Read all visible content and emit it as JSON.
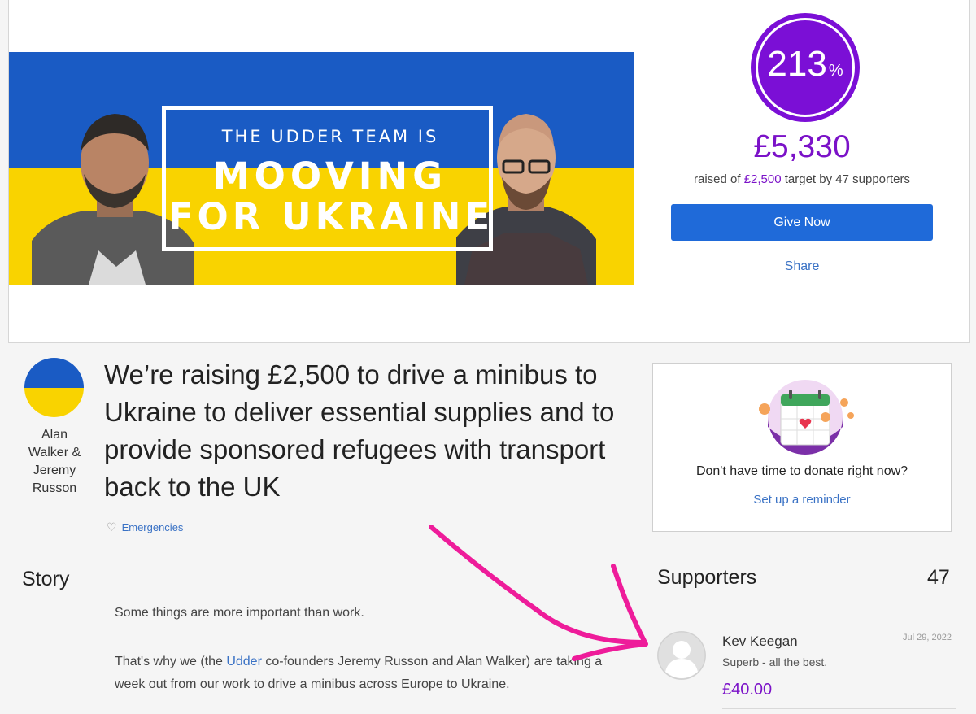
{
  "banner": {
    "line1": "THE UDDER TEAM IS",
    "line2": "MOOVING",
    "line3": "FOR UKRAINE"
  },
  "progress": {
    "percent": "213",
    "percent_symbol": "%",
    "amount": "£5,330",
    "raised_of": "raised of ",
    "target": "£2,500",
    "target_by": " target by ",
    "supporters_count": "47",
    "supporters_label": " supporters"
  },
  "actions": {
    "give_now": "Give Now",
    "share": "Share"
  },
  "owner": {
    "name_lines": [
      "Alan",
      "Walker &",
      "Jeremy",
      "Russon"
    ]
  },
  "campaign": {
    "title": "We’re raising £2,500 to drive a minibus to Ukraine to deliver essential supplies and to provide sponsored refugees with transport back to the UK",
    "category": "Emergencies"
  },
  "reminder": {
    "text": "Don't have time to donate right now?",
    "link": "Set up a reminder"
  },
  "story": {
    "heading": "Story",
    "p1": "Some things are more important than work.",
    "p2_before": "That's why we (the ",
    "p2_link": "Udder",
    "p2_after": " co-founders Jeremy Russon and Alan Walker) are taking a week out from our work to drive a minibus across Europe to Ukraine."
  },
  "supporters": {
    "heading": "Supporters",
    "count": "47",
    "items": [
      {
        "name": "Kev Keegan",
        "date": "Jul 29, 2022",
        "message": "Superb - all the best.",
        "amount": "£40.00"
      }
    ]
  },
  "colors": {
    "brand_purple": "#7b12c8",
    "button_blue": "#1f6ad9",
    "link_blue": "#3a72c5",
    "ukraine_blue": "#1a5bc4",
    "ukraine_yellow": "#f9d300",
    "arrow_magenta": "#ee1c9a"
  }
}
